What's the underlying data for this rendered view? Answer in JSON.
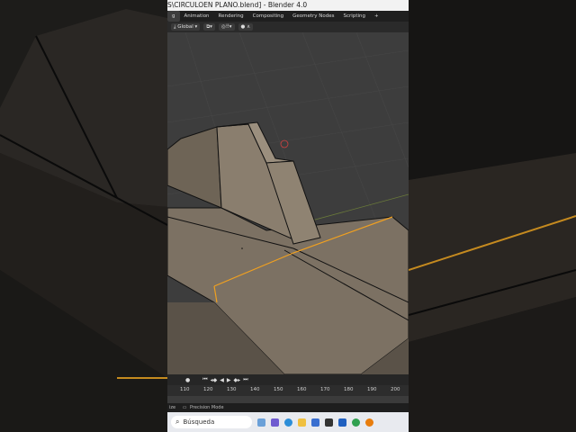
{
  "window": {
    "title": "S\\CIRCULOEN PLANO.blend] - Blender 4.0"
  },
  "menubar": {
    "items": [
      "g",
      "Animation",
      "Rendering",
      "Compositing",
      "Geometry Nodes",
      "Scripting",
      "+"
    ],
    "active_index": 0
  },
  "toolbar": {
    "orientation": "Global"
  },
  "timeline": {
    "ticks": [
      "110",
      "120",
      "130",
      "140",
      "150",
      "160",
      "170",
      "180",
      "190",
      "200"
    ]
  },
  "statusbar": {
    "left": "ize",
    "mode": "Precision Mode"
  },
  "taskbar": {
    "search_placeholder": "Búsqueda"
  },
  "colors": {
    "accent_edge": "#f0a020",
    "surface": "#7f7466",
    "bg": "#3d3d3d"
  }
}
